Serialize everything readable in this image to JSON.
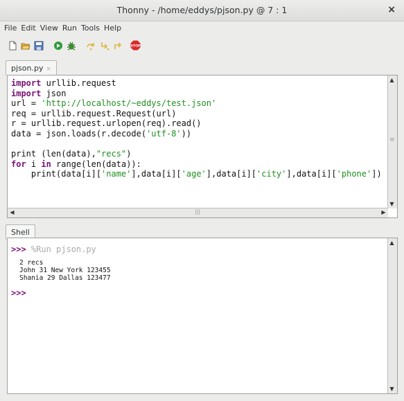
{
  "window": {
    "title": "Thonny  -  /home/eddys/pjson.py  @  7 : 1",
    "close_glyph": "×"
  },
  "menu": [
    "File",
    "Edit",
    "View",
    "Run",
    "Tools",
    "Help"
  ],
  "toolbar": {
    "icons": [
      "new-file-icon",
      "open-file-icon",
      "save-file-icon",
      "run-icon",
      "debug-icon",
      "step-over-icon",
      "step-into-icon",
      "step-out-icon",
      "stop-icon"
    ],
    "stop_label": "STOP"
  },
  "editor": {
    "tab_label": "pjson.py",
    "tab_close": "×",
    "lines": [
      [
        {
          "t": "import",
          "c": "kw"
        },
        {
          "t": " urllib.request"
        }
      ],
      [
        {
          "t": "import",
          "c": "kw"
        },
        {
          "t": " json"
        }
      ],
      [
        {
          "t": "url = "
        },
        {
          "t": "'http://localhost/~eddys/test.json'",
          "c": "str"
        }
      ],
      [
        {
          "t": "req = urllib.request.Request(url)"
        }
      ],
      [
        {
          "t": "r = urllib.request.urlopen(req).read()"
        }
      ],
      [
        {
          "t": "data = json.loads(r.decode("
        },
        {
          "t": "'utf-8'",
          "c": "str"
        },
        {
          "t": "))"
        }
      ],
      [
        {
          "t": ""
        }
      ],
      [
        {
          "t": "print (len(data),"
        },
        {
          "t": "\"recs\"",
          "c": "str"
        },
        {
          "t": ")"
        }
      ],
      [
        {
          "t": "for",
          "c": "kw"
        },
        {
          "t": " i "
        },
        {
          "t": "in",
          "c": "kw"
        },
        {
          "t": " range(len(data)):"
        }
      ],
      [
        {
          "t": "    print(data[i]["
        },
        {
          "t": "'name'",
          "c": "str"
        },
        {
          "t": "],data[i]["
        },
        {
          "t": "'age'",
          "c": "str"
        },
        {
          "t": "],data[i]["
        },
        {
          "t": "'city'",
          "c": "str"
        },
        {
          "t": "],data[i]["
        },
        {
          "t": "'phone'",
          "c": "str"
        },
        {
          "t": "])"
        }
      ]
    ]
  },
  "shell": {
    "tab_label": "Shell",
    "prompt": ">>>",
    "command": " %Run pjson.py",
    "output": [
      "2 recs",
      "John 31 New York 123455",
      "Shania 29 Dallas 123477"
    ],
    "final_prompt": ">>>"
  }
}
